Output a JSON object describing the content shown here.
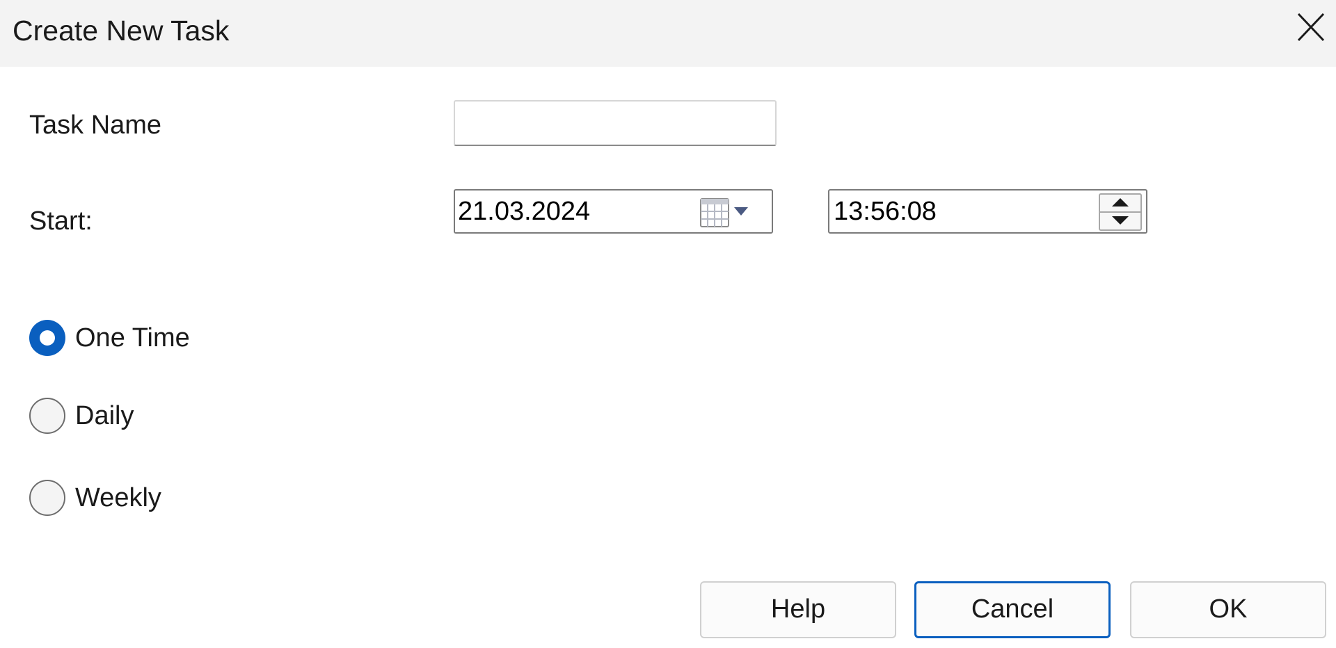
{
  "window": {
    "title": "Create New Task",
    "close_icon": "close-icon"
  },
  "form": {
    "task_name_label": "Task Name",
    "task_name_value": "",
    "start_label": "Start:",
    "start_date": "21.03.2024",
    "start_time": "13:56:08",
    "calendar_icon": "calendar-dropdown-icon",
    "spin_icons": [
      "spin-up-icon",
      "spin-down-icon"
    ]
  },
  "schedule": {
    "options": [
      {
        "label": "One Time",
        "selected": true
      },
      {
        "label": "Daily",
        "selected": false
      },
      {
        "label": "Weekly",
        "selected": false
      }
    ]
  },
  "buttons": {
    "help": "Help",
    "cancel": "Cancel",
    "ok": "OK",
    "focused": "Cancel"
  },
  "colors": {
    "accent": "#0a5fbf",
    "titlebar_bg": "#f3f3f3"
  }
}
